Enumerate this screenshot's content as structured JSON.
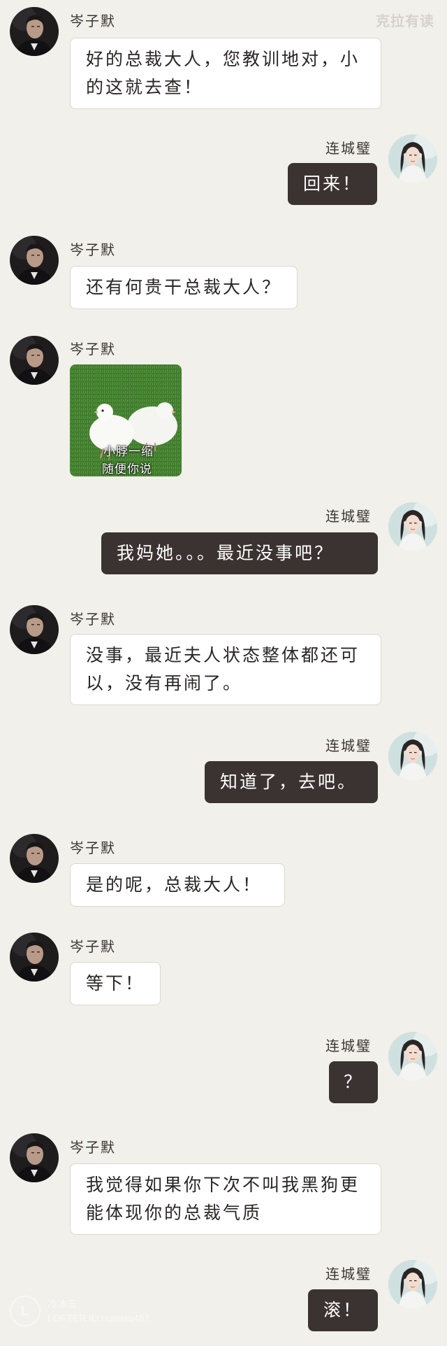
{
  "watermark_top": "克拉有读",
  "contacts": {
    "left_name": "岑子默",
    "right_name": "连城璧"
  },
  "messages": [
    {
      "text": "好的总裁大人，您教训地对，小的这就去查！"
    },
    {
      "text": "回来！"
    },
    {
      "text": "还有何贵干总裁大人？"
    },
    {
      "sticker_caption_1": "小脖一缩",
      "sticker_caption_2": "随便你说"
    },
    {
      "text": "我妈她。。。最近没事吧？"
    },
    {
      "text": "没事，最近夫人状态整体都还可以，没有再闹了。"
    },
    {
      "text": "知道了，去吧。"
    },
    {
      "text": "是的呢，总裁大人！"
    },
    {
      "text": "等下！"
    },
    {
      "text": "？"
    },
    {
      "text": "我觉得如果你下次不叫我黑狗更能体现你的总裁气质"
    },
    {
      "text": "滚！"
    }
  ],
  "watermark_bottom": {
    "logo_letter": "L",
    "line1": "冷冰去",
    "line2": "LOFTER ID:numiaa487"
  }
}
